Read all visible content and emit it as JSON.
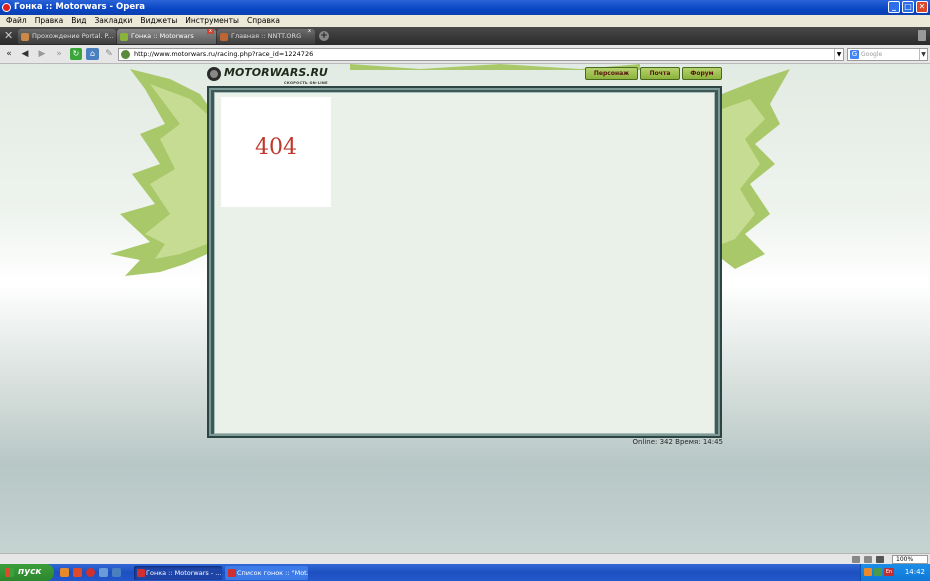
{
  "window": {
    "title": "Гонка :: Motorwars - Opera",
    "buttons": [
      "_",
      "□",
      "✕"
    ]
  },
  "menu": [
    "Файл",
    "Правка",
    "Вид",
    "Закладки",
    "Виджеты",
    "Инструменты",
    "Справка"
  ],
  "tabs": [
    {
      "label": "Прохождение Portal. P...",
      "active": false
    },
    {
      "label": "Гонка :: Motorwars",
      "active": true
    },
    {
      "label": "Главная :: NNTT.ORG",
      "active": false
    }
  ],
  "address": {
    "url": "http://www.motorwars.ru/racing.php?race_id=1224726",
    "search_placeholder": "Google"
  },
  "site": {
    "logo": "MOTORWARS.RU",
    "tagline": "СКОРОСТЬ ON-LINE",
    "nav": [
      "Персонаж",
      "Почта",
      "Форум"
    ],
    "error": "404",
    "status": "Online: 342  Время: 14:45"
  },
  "statusbar": {
    "zoom": "100%"
  },
  "taskbar": {
    "start": "пуск",
    "tasks": [
      {
        "label": "Гонка :: Motorwars - ...",
        "active": true
      },
      {
        "label": "Список гонок :: \"Mot...",
        "active": false
      }
    ],
    "lang": "En",
    "clock": "14:42"
  },
  "colors": {
    "accent_green": "#8bb33c",
    "error_red": "#c0382b",
    "frame": "#3d5a58"
  }
}
